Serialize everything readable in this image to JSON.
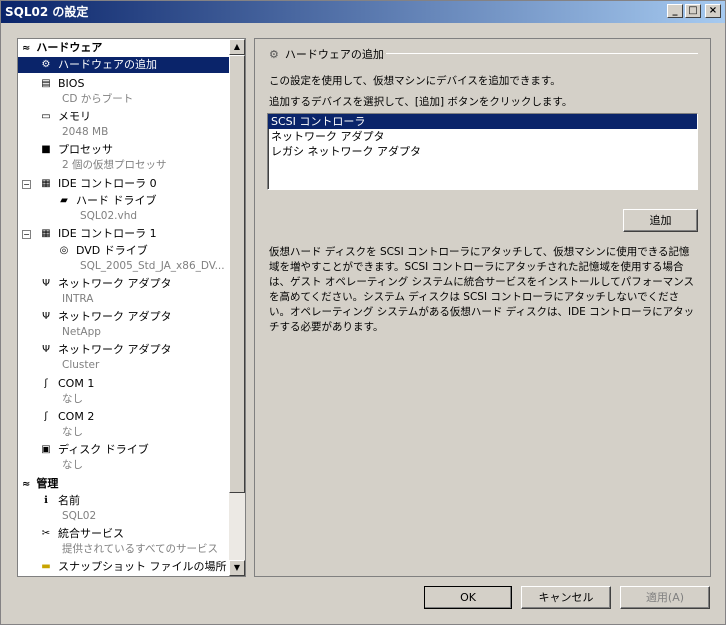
{
  "window": {
    "title": "SQL02 の設定",
    "min": "_",
    "max": "□",
    "close": "×"
  },
  "tree": {
    "hw_header": "ハードウェア",
    "mgmt_header": "管理",
    "items": [
      {
        "label": "ハードウェアの追加",
        "sub": ""
      },
      {
        "label": "BIOS",
        "sub": "CD からブート"
      },
      {
        "label": "メモリ",
        "sub": "2048 MB"
      },
      {
        "label": "プロセッサ",
        "sub": "2 個の仮想プロセッサ"
      },
      {
        "label": "IDE コントローラ 0",
        "sub": ""
      },
      {
        "label": "ハード ドライブ",
        "sub": "SQL02.vhd"
      },
      {
        "label": "IDE コントローラ 1",
        "sub": ""
      },
      {
        "label": "DVD ドライブ",
        "sub": "SQL_2005_Std_JA_x86_DV..."
      },
      {
        "label": "ネットワーク アダプタ",
        "sub": "INTRA"
      },
      {
        "label": "ネットワーク アダプタ",
        "sub": "NetApp"
      },
      {
        "label": "ネットワーク アダプタ",
        "sub": "Cluster"
      },
      {
        "label": "COM 1",
        "sub": "なし"
      },
      {
        "label": "COM 2",
        "sub": "なし"
      },
      {
        "label": "ディスク ドライブ",
        "sub": "なし"
      },
      {
        "label": "名前",
        "sub": "SQL02"
      },
      {
        "label": "統合サービス",
        "sub": "提供されているすべてのサービス"
      },
      {
        "label": "スナップショット ファイルの場所",
        "sub": ""
      }
    ],
    "expander_minus": "−"
  },
  "panel": {
    "heading": "ハードウェアの追加",
    "line1": "この設定を使用して、仮想マシンにデバイスを追加できます。",
    "line2": "追加するデバイスを選択して、[追加] ボタンをクリックします。",
    "devices": [
      "SCSI コントローラ",
      "ネットワーク アダプタ",
      "レガシ ネットワーク アダプタ"
    ],
    "add_button": "追加",
    "description": "仮想ハード ディスクを SCSI コントローラにアタッチして、仮想マシンに使用できる記憶域を増やすことができます。SCSI コントローラにアタッチされた記憶域を使用する場合は、ゲスト オペレーティング システムに統合サービスをインストールしてパフォーマンスを高めてください。システム ディスクは SCSI コントローラにアタッチしないでください。オペレーティング システムがある仮想ハード ディスクは、IDE コントローラにアタッチする必要があります。"
  },
  "footer": {
    "ok": "OK",
    "cancel": "キャンセル",
    "apply": "適用(A)"
  },
  "icons": {
    "chevron": "⌃",
    "collapse_chev": "»"
  }
}
